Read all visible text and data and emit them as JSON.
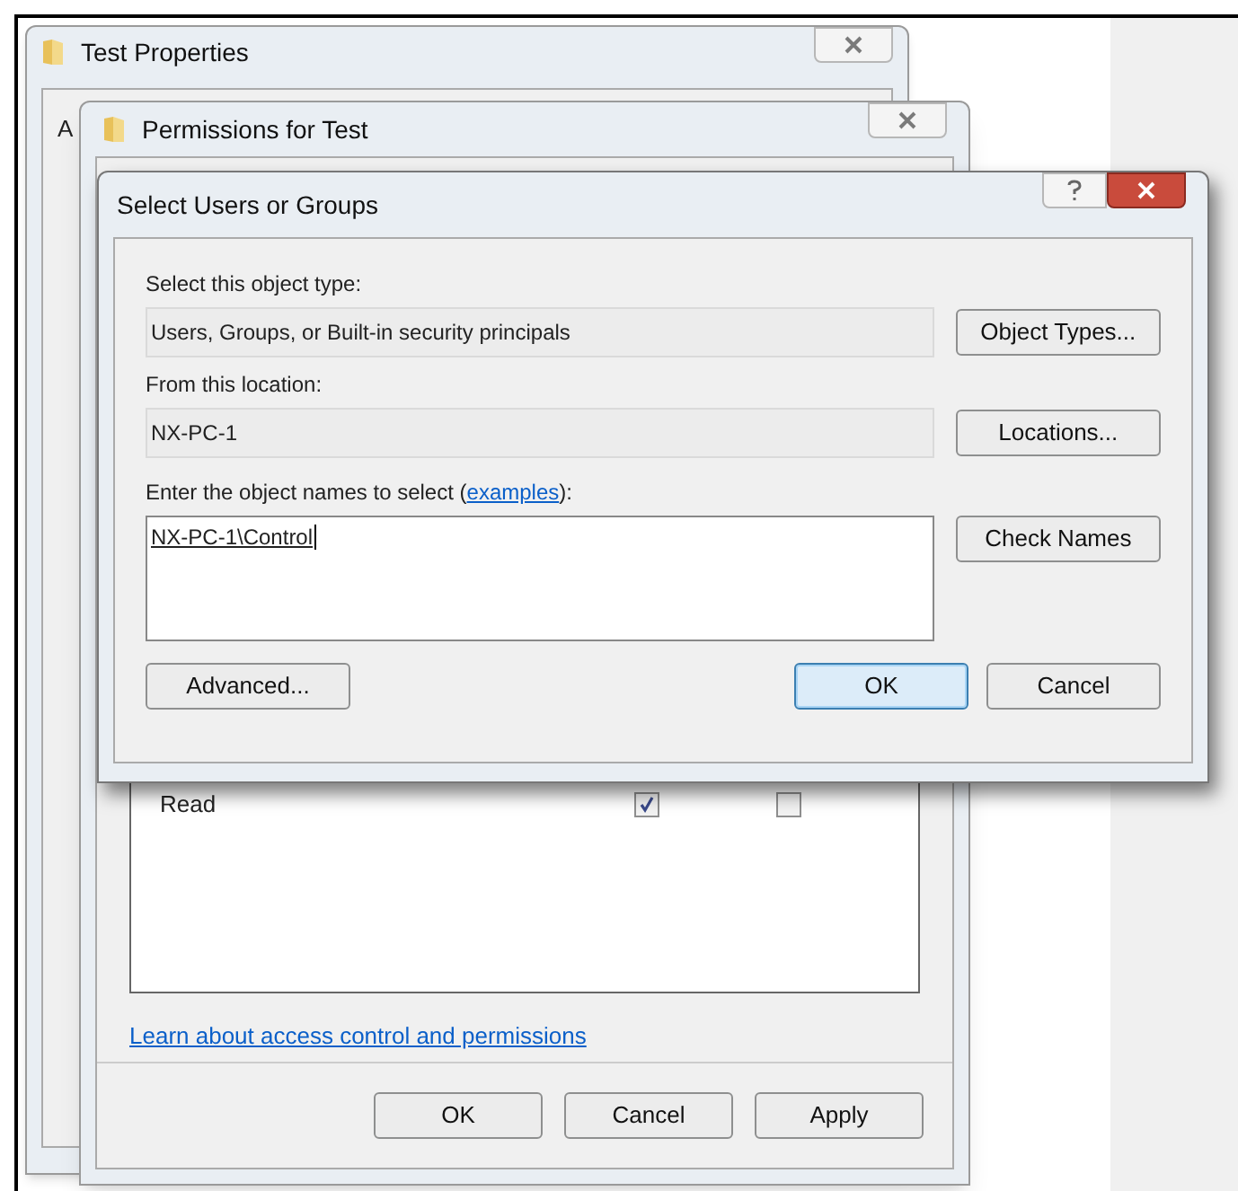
{
  "back_window": {
    "title": "Test Properties",
    "tab_fragment": "A"
  },
  "permissions_window": {
    "title": "Permissions for Test",
    "rows": [
      {
        "name": "Read",
        "allow": true,
        "deny": false
      }
    ],
    "link": "Learn about access control and permissions",
    "buttons": [
      {
        "label": "OK",
        "default": false
      },
      {
        "label": "Cancel",
        "default": false
      },
      {
        "label": "Apply",
        "default": false
      }
    ]
  },
  "select_dialog": {
    "title": "Select Users or Groups",
    "object_type": {
      "label": "Select this object type:",
      "value": "Users, Groups, or Built-in security principals",
      "button": "Object Types..."
    },
    "location": {
      "label": "From this location:",
      "value": "NX-PC-1",
      "button": "Locations..."
    },
    "names": {
      "label_before": "Enter the object names to select (",
      "link": "examples",
      "label_after": "):",
      "value": "NX-PC-1\\Control",
      "button": "Check Names"
    },
    "advanced_button": "Advanced...",
    "buttons": [
      {
        "label": "OK",
        "default": true
      },
      {
        "label": "Cancel",
        "default": false
      }
    ]
  }
}
